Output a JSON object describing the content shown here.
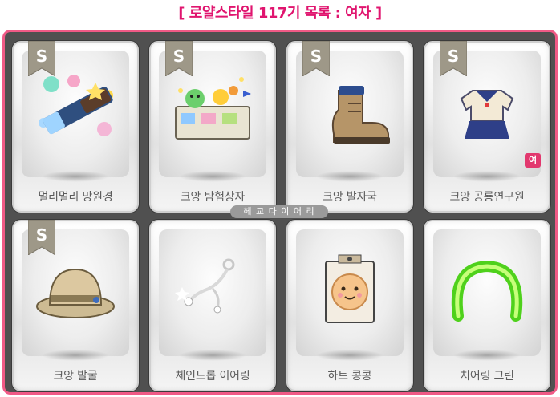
{
  "header": {
    "title": "[ 로얄스타일 117기 목록 : 여자 ]"
  },
  "watermark": "헤 교 다 이 어 리",
  "colors": {
    "accent": "#e0156f",
    "frame_border": "#f05a86",
    "frame_bg": "#505050"
  },
  "items": [
    {
      "name": "멀리멀리 망원경",
      "grade": "S",
      "icon": "telescope-icon"
    },
    {
      "name": "크앙 탐험상자",
      "grade": "S",
      "icon": "treasure-box-icon"
    },
    {
      "name": "크앙 발자국",
      "grade": "S",
      "icon": "boot-icon"
    },
    {
      "name": "크앙 공룡연구원",
      "grade": "S",
      "icon": "sailor-outfit-icon",
      "badge": "여"
    },
    {
      "name": "크앙 발굴",
      "grade": "S",
      "icon": "explorer-hat-icon"
    },
    {
      "name": "체인드롭 이어링",
      "icon": "earring-icon"
    },
    {
      "name": "하트 콩콩",
      "icon": "heart-face-icon"
    },
    {
      "name": "치어링 그린",
      "icon": "green-ring-icon"
    }
  ]
}
